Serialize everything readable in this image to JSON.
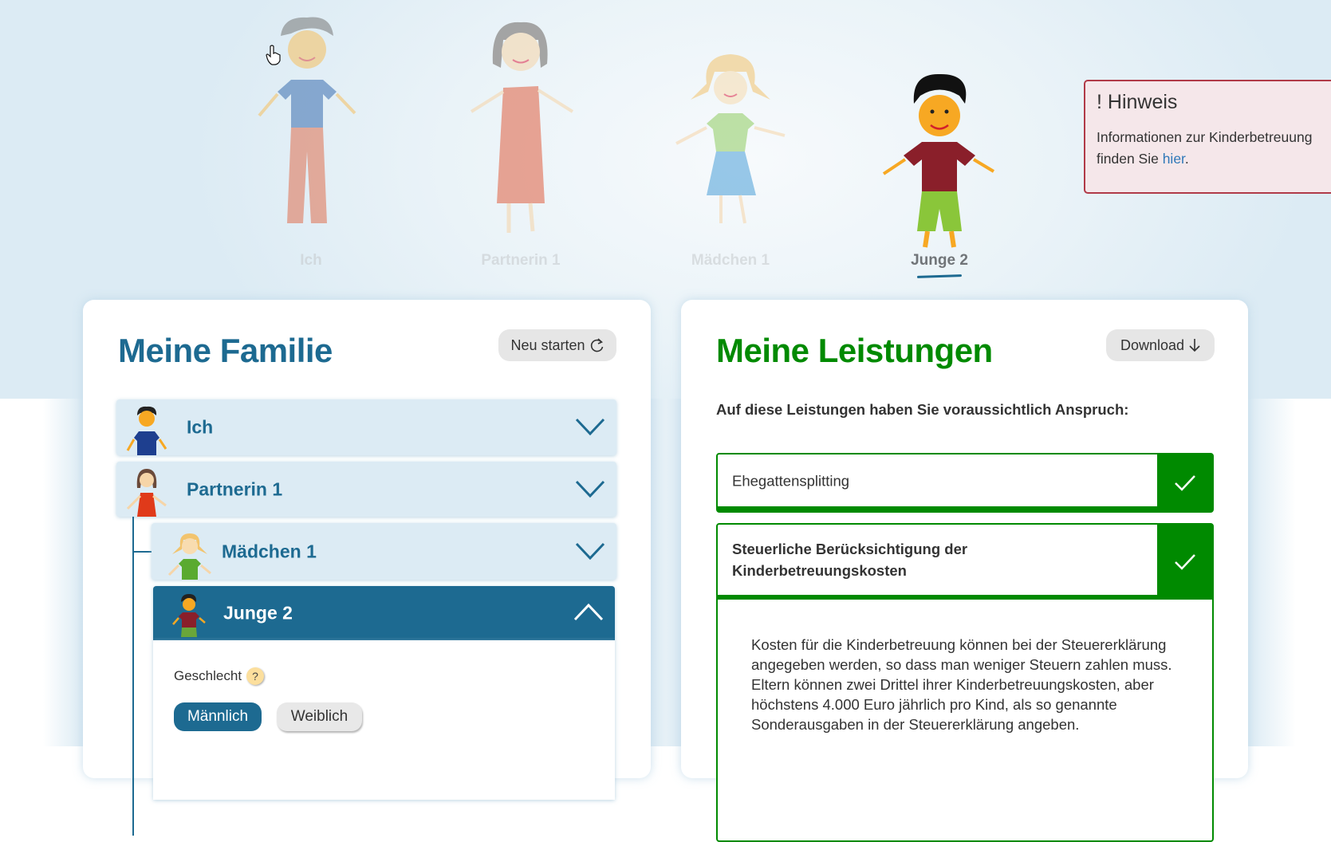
{
  "family_figures": [
    {
      "label": "Ich",
      "active": false
    },
    {
      "label": "Partnerin 1",
      "active": false
    },
    {
      "label": "Mädchen 1",
      "active": false
    },
    {
      "label": "Junge 2",
      "active": true
    }
  ],
  "hinweis": {
    "title": "! Hinweis",
    "text_before": "Informationen zur Kinderbetreuung finden Sie ",
    "link": "hier",
    "text_after": "."
  },
  "family": {
    "title": "Meine Familie",
    "restart_label": "Neu starten",
    "members": [
      {
        "label": "Ich",
        "expanded": false
      },
      {
        "label": "Partnerin 1",
        "expanded": false
      },
      {
        "label": "Mädchen 1",
        "expanded": false
      },
      {
        "label": "Junge 2",
        "expanded": true
      }
    ],
    "gender_label": "Geschlecht",
    "help_label": "?",
    "gender_options": [
      "Männlich",
      "Weiblich"
    ],
    "gender_selected": "Männlich"
  },
  "benefits": {
    "title": "Meine Leistungen",
    "download_label": "Download",
    "intro": "Auf diese Leistungen haben Sie voraussichtlich Anspruch:",
    "items": [
      {
        "title": "Ehegattensplitting",
        "eligible": true,
        "expanded": false
      },
      {
        "title": "Steuerliche Berücksichtigung der Kinderbetreuungskosten",
        "eligible": true,
        "expanded": true,
        "description": "Kosten für die Kinderbetreuung können bei der Steuererklärung angegeben werden, so dass man weniger Steuern zahlen muss. Eltern können zwei Drittel ihrer Kinderbetreuungskosten, aber höchstens 4.000 Euro jährlich pro Kind, als so genannte Sonderausgaben in der Steuererklärung angeben."
      }
    ]
  },
  "colors": {
    "primary_blue": "#1d6a91",
    "success_green": "#008a00",
    "hint_border": "#b03a48",
    "hint_bg": "#f5e7ea",
    "accordion_bg": "#dcebf4"
  }
}
